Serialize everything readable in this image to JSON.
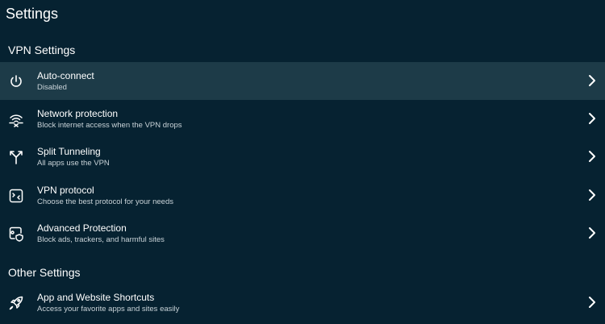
{
  "header": {
    "title": "Settings"
  },
  "sections": {
    "vpn": {
      "title": "VPN Settings",
      "items": [
        {
          "label": "Auto-connect",
          "sub": "Disabled",
          "icon": "power-icon",
          "selected": true
        },
        {
          "label": "Network protection",
          "sub": "Block internet access when the VPN drops",
          "icon": "network-protection-icon"
        },
        {
          "label": "Split Tunneling",
          "sub": "All apps use the VPN",
          "icon": "split-tunnel-icon"
        },
        {
          "label": "VPN protocol",
          "sub": "Choose the best protocol for your needs",
          "icon": "protocol-icon"
        },
        {
          "label": "Advanced Protection",
          "sub": "Block ads, trackers, and harmful sites",
          "icon": "shield-icon"
        }
      ]
    },
    "other": {
      "title": "Other Settings",
      "items": [
        {
          "label": "App and Website Shortcuts",
          "sub": "Access your favorite apps and sites easily",
          "icon": "rocket-icon"
        }
      ]
    }
  },
  "colors": {
    "background": "#062231",
    "selected_row": "#1d3b48",
    "text": "#ffffff",
    "subtext": "#c9d3d8"
  }
}
